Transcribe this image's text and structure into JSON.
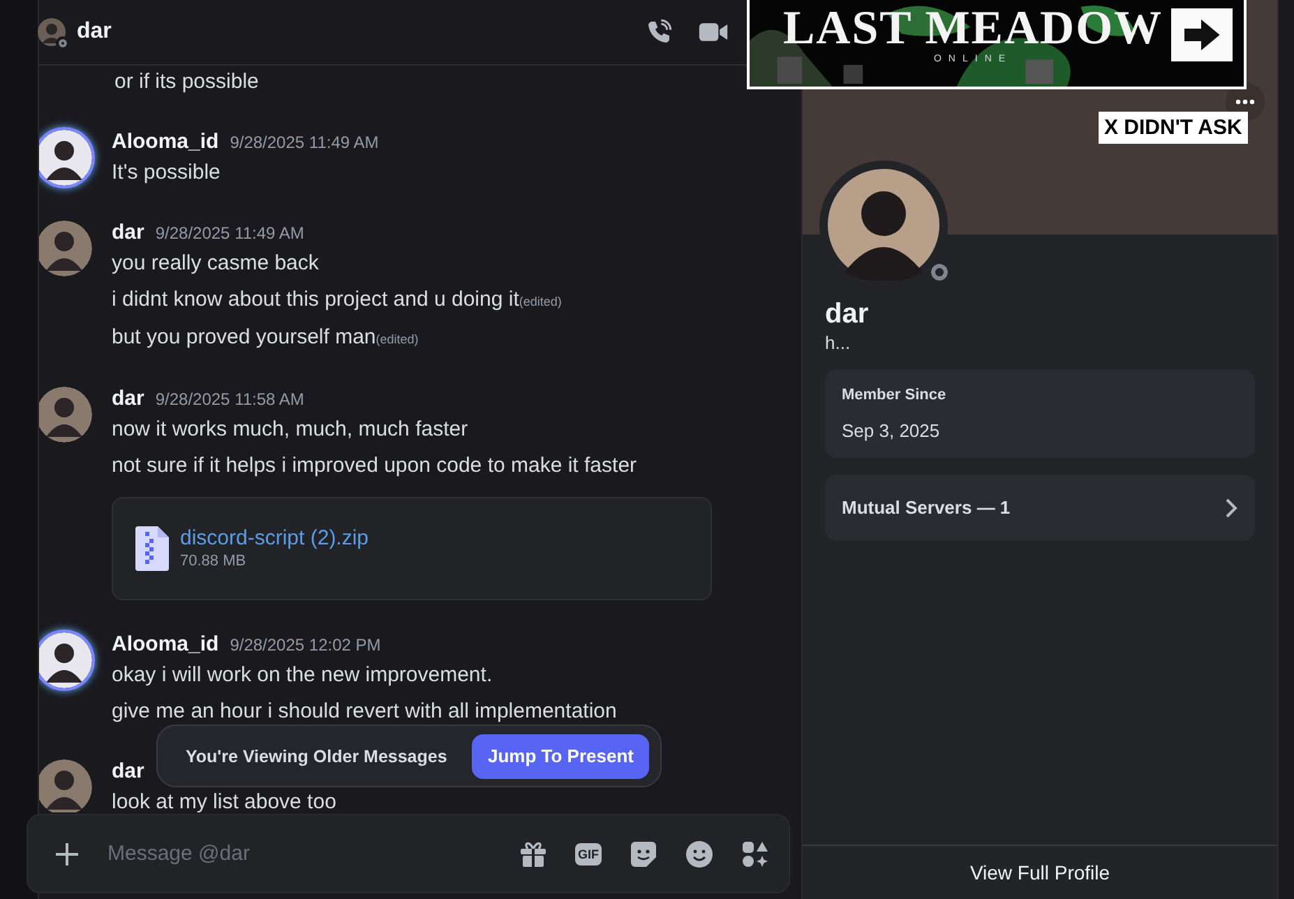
{
  "header": {
    "name": "dar",
    "online": false
  },
  "banner_overlay": {
    "title": "LAST MEADOW",
    "subtitle": "ONLINE"
  },
  "sticker_label": "X DIDN'T ASK",
  "messages": [
    {
      "lines": [
        {
          "text": "or if its possible"
        }
      ]
    },
    {
      "author": "Alooma_id",
      "time": "9/28/2025 11:49 AM",
      "avatar_ring": true,
      "lines": [
        {
          "text": "It's possible"
        }
      ]
    },
    {
      "author": "dar",
      "time": "9/28/2025 11:49 AM",
      "avatar_ring": false,
      "lines": [
        {
          "text": "you really casme back"
        },
        {
          "text": "i didnt know about this project and u doing it",
          "edited_mark": "(edited)"
        },
        {
          "text": "but you proved yourself man",
          "edited_mark": "(edited)"
        }
      ]
    },
    {
      "author": "dar",
      "time": "9/28/2025 11:58 AM",
      "avatar_ring": false,
      "lines": [
        {
          "text": "now it works much, much, much faster"
        },
        {
          "text": "not sure if it helps i improved upon code to make it faster"
        }
      ],
      "attachment": {
        "name": "discord-script (2).zip",
        "size": "70.88 MB"
      }
    },
    {
      "author": "Alooma_id",
      "time": "9/28/2025 12:02 PM",
      "avatar_ring": true,
      "lines": [
        {
          "text": "okay i will work on the new improvement."
        },
        {
          "text": "give me an hour i should revert with all implementation"
        }
      ]
    },
    {
      "author": "dar",
      "avatar_ring": false,
      "lines": [
        {
          "text": "look at my list above too"
        }
      ]
    }
  ],
  "older_notice": {
    "text": "You're Viewing Older Messages",
    "button": "Jump To Present"
  },
  "composer": {
    "placeholder": "Message @dar",
    "tools": [
      {
        "kind": "gift"
      },
      {
        "kind": "gif",
        "label": "GIF"
      },
      {
        "kind": "sticker"
      },
      {
        "kind": "emoji"
      },
      {
        "kind": "apps"
      }
    ]
  },
  "profile": {
    "name": "dar",
    "status_text": "h...",
    "online": false,
    "member_since_label": "Member Since",
    "member_since": "Sep 3, 2025",
    "mutual_servers": "Mutual Servers — 1",
    "footer": "View Full Profile"
  }
}
